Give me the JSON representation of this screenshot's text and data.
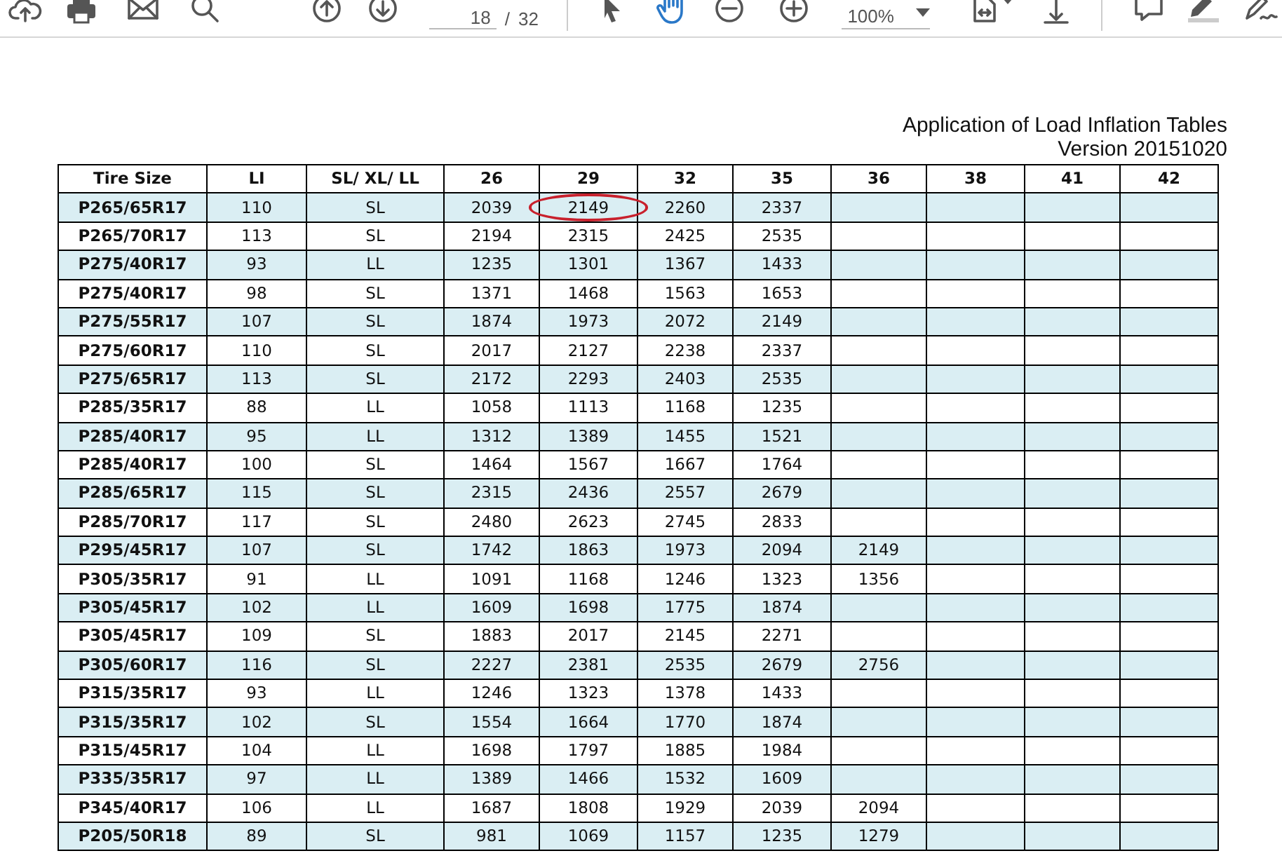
{
  "toolbar": {
    "page_current": "18",
    "page_separator": "/",
    "page_total": "32",
    "zoom": "100%",
    "tools": [
      {
        "kind": "pointer",
        "selected": false
      },
      {
        "kind": "hand",
        "selected": true
      }
    ]
  },
  "heading": {
    "title": "Application of Load Inflation Tables",
    "version": "Version 20151020"
  },
  "table": {
    "columns": [
      "Tire Size",
      "LI",
      "SL/ XL/ LL",
      "26",
      "29",
      "32",
      "35",
      "36",
      "38",
      "41",
      "42"
    ],
    "rows": [
      {
        "tire_size": "P265/65R17",
        "li": "110",
        "load_range": "SL",
        "pressures": [
          "2039",
          "2149",
          "2260",
          "2337"
        ],
        "circled": [
          false,
          true,
          false,
          false
        ],
        "shaded": true
      },
      {
        "tire_size": "P265/70R17",
        "li": "113",
        "load_range": "SL",
        "pressures": [
          "2194",
          "2315",
          "2425",
          "2535"
        ],
        "circled": [
          false,
          false,
          false,
          false
        ],
        "shaded": false
      },
      {
        "tire_size": "P275/40R17",
        "li": "93",
        "load_range": "LL",
        "pressures": [
          "1235",
          "1301",
          "1367",
          "1433"
        ],
        "circled": [
          false,
          false,
          false,
          false
        ],
        "shaded": true
      },
      {
        "tire_size": "P275/40R17",
        "li": "98",
        "load_range": "SL",
        "pressures": [
          "1371",
          "1468",
          "1563",
          "1653"
        ],
        "circled": [
          false,
          false,
          false,
          false
        ],
        "shaded": false
      },
      {
        "tire_size": "P275/55R17",
        "li": "107",
        "load_range": "SL",
        "pressures": [
          "1874",
          "1973",
          "2072",
          "2149"
        ],
        "circled": [
          false,
          false,
          false,
          false
        ],
        "shaded": true
      },
      {
        "tire_size": "P275/60R17",
        "li": "110",
        "load_range": "SL",
        "pressures": [
          "2017",
          "2127",
          "2238",
          "2337"
        ],
        "circled": [
          false,
          false,
          false,
          false
        ],
        "shaded": false
      },
      {
        "tire_size": "P275/65R17",
        "li": "113",
        "load_range": "SL",
        "pressures": [
          "2172",
          "2293",
          "2403",
          "2535"
        ],
        "circled": [
          false,
          false,
          false,
          false
        ],
        "shaded": true
      },
      {
        "tire_size": "P285/35R17",
        "li": "88",
        "load_range": "LL",
        "pressures": [
          "1058",
          "1113",
          "1168",
          "1235"
        ],
        "circled": [
          false,
          false,
          false,
          false
        ],
        "shaded": false
      },
      {
        "tire_size": "P285/40R17",
        "li": "95",
        "load_range": "LL",
        "pressures": [
          "1312",
          "1389",
          "1455",
          "1521"
        ],
        "circled": [
          false,
          false,
          false,
          false
        ],
        "shaded": true
      },
      {
        "tire_size": "P285/40R17",
        "li": "100",
        "load_range": "SL",
        "pressures": [
          "1464",
          "1567",
          "1667",
          "1764"
        ],
        "circled": [
          false,
          false,
          false,
          false
        ],
        "shaded": false
      },
      {
        "tire_size": "P285/65R17",
        "li": "115",
        "load_range": "SL",
        "pressures": [
          "2315",
          "2436",
          "2557",
          "2679"
        ],
        "circled": [
          false,
          false,
          false,
          false
        ],
        "shaded": true
      },
      {
        "tire_size": "P285/70R17",
        "li": "117",
        "load_range": "SL",
        "pressures": [
          "2480",
          "2623",
          "2745",
          "2833"
        ],
        "circled": [
          false,
          false,
          false,
          false
        ],
        "shaded": false
      },
      {
        "tire_size": "P295/45R17",
        "li": "107",
        "load_range": "SL",
        "pressures": [
          "1742",
          "1863",
          "1973",
          "2094",
          "2149"
        ],
        "circled": [
          false,
          false,
          false,
          false,
          false
        ],
        "shaded": true
      },
      {
        "tire_size": "P305/35R17",
        "li": "91",
        "load_range": "LL",
        "pressures": [
          "1091",
          "1168",
          "1246",
          "1323",
          "1356"
        ],
        "circled": [
          false,
          false,
          false,
          false,
          false
        ],
        "shaded": false
      },
      {
        "tire_size": "P305/45R17",
        "li": "102",
        "load_range": "LL",
        "pressures": [
          "1609",
          "1698",
          "1775",
          "1874"
        ],
        "circled": [
          false,
          false,
          false,
          false
        ],
        "shaded": true
      },
      {
        "tire_size": "P305/45R17",
        "li": "109",
        "load_range": "SL",
        "pressures": [
          "1883",
          "2017",
          "2145",
          "2271"
        ],
        "circled": [
          false,
          false,
          false,
          false
        ],
        "shaded": false
      },
      {
        "tire_size": "P305/60R17",
        "li": "116",
        "load_range": "SL",
        "pressures": [
          "2227",
          "2381",
          "2535",
          "2679",
          "2756"
        ],
        "circled": [
          false,
          false,
          false,
          false,
          false
        ],
        "shaded": true
      },
      {
        "tire_size": "P315/35R17",
        "li": "93",
        "load_range": "LL",
        "pressures": [
          "1246",
          "1323",
          "1378",
          "1433"
        ],
        "circled": [
          false,
          false,
          false,
          false
        ],
        "shaded": false
      },
      {
        "tire_size": "P315/35R17",
        "li": "102",
        "load_range": "SL",
        "pressures": [
          "1554",
          "1664",
          "1770",
          "1874"
        ],
        "circled": [
          false,
          false,
          false,
          false
        ],
        "shaded": true
      },
      {
        "tire_size": "P315/45R17",
        "li": "104",
        "load_range": "LL",
        "pressures": [
          "1698",
          "1797",
          "1885",
          "1984"
        ],
        "circled": [
          false,
          false,
          false,
          false
        ],
        "shaded": false
      },
      {
        "tire_size": "P335/35R17",
        "li": "97",
        "load_range": "LL",
        "pressures": [
          "1389",
          "1466",
          "1532",
          "1609"
        ],
        "circled": [
          false,
          false,
          false,
          false
        ],
        "shaded": true
      },
      {
        "tire_size": "P345/40R17",
        "li": "106",
        "load_range": "LL",
        "pressures": [
          "1687",
          "1808",
          "1929",
          "2039",
          "2094"
        ],
        "circled": [
          false,
          false,
          false,
          false,
          false
        ],
        "shaded": false
      },
      {
        "tire_size": "P205/50R18",
        "li": "89",
        "load_range": "SL",
        "pressures": [
          "981",
          "1069",
          "1157",
          "1235",
          "1279"
        ],
        "circled": [
          false,
          false,
          false,
          false,
          false
        ],
        "shaded": true
      }
    ]
  }
}
